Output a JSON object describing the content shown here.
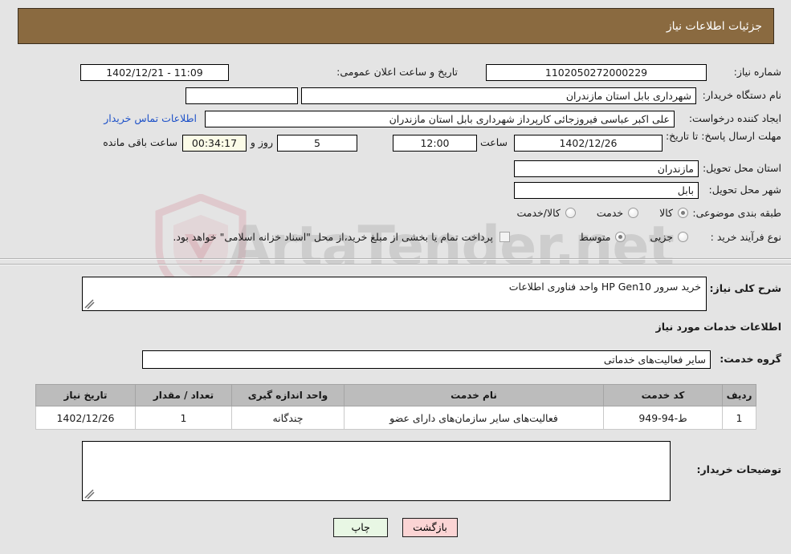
{
  "header": {
    "title": "جزئیات اطلاعات نیاز"
  },
  "colors": {
    "header_bg": "#8a6a40",
    "page_bg": "#e4e4e4",
    "link": "#1d51c8",
    "table_header_bg": "#bcbcbc",
    "print_btn_bg": "#e8f7e4",
    "back_btn_bg": "#fbd4d4",
    "countdown_bg": "#fbfbe7"
  },
  "form": {
    "need_number_label": "شماره نیاز:",
    "need_number_value": "1102050272000229",
    "announce_label": "تاریخ و ساعت اعلان عمومی:",
    "announce_value": "11:09 - 1402/12/21",
    "buyer_org_label": "نام دستگاه خریدار:",
    "buyer_org_value": "شهرداری بابل استان مازندران",
    "buyer_org_value_2": "",
    "creator_label": "ایجاد کننده درخواست:",
    "creator_value": "علی اکبر عباسی فیروزجائی کارپرداز شهرداری بابل استان مازندران",
    "contact_link": "اطلاعات تماس خریدار",
    "deadline_label": "مهلت ارسال پاسخ: تا تاریخ:",
    "deadline_date": "1402/12/26",
    "hour_label": "ساعت",
    "hour_value": "12:00",
    "days_value": "5",
    "days_label": "روز و",
    "countdown_value": "00:34:17",
    "remaining_label": "ساعت باقی مانده",
    "province_label": "استان محل تحویل:",
    "province_value": "مازندران",
    "city_label": "شهر محل تحویل:",
    "city_value": "بابل",
    "category_label": "طبقه بندی موضوعی:",
    "category_options": [
      "کالا",
      "خدمت",
      "کالا/خدمت"
    ],
    "category_selected": "کالا",
    "process_label": "نوع فرآیند خرید :",
    "process_options": [
      "جزیی",
      "متوسط"
    ],
    "process_selected": "متوسط",
    "treasury_checkbox_label": "پرداخت تمام یا بخشی از مبلغ خرید،از محل \"اسناد خزانه اسلامی\" خواهد بود.",
    "treasury_checked": false
  },
  "description": {
    "label": "شرح کلی نیاز:",
    "value": "خرید سرور HP Gen10 واحد فناوری اطلاعات"
  },
  "services_section": {
    "heading": "اطلاعات خدمات مورد نیاز",
    "group_label": "گروه خدمت:",
    "group_value": "سایر فعالیت‌های خدماتی"
  },
  "table": {
    "headers": [
      "ردیف",
      "کد خدمت",
      "نام خدمت",
      "واحد اندازه گیری",
      "تعداد / مقدار",
      "تاریخ نیاز"
    ],
    "rows": [
      {
        "row_no": "1",
        "service_code": "ط-94-949",
        "service_name": "فعالیت‌های سایر سازمان‌های دارای عضو",
        "unit": "چندگانه",
        "quantity": "1",
        "need_date": "1402/12/26"
      }
    ]
  },
  "buyer_notes": {
    "label": "توضیحات خریدار:",
    "value": ""
  },
  "buttons": {
    "print": "چاپ",
    "back": "بازگشت"
  },
  "watermark": {
    "text": "ArtaTender.net"
  }
}
